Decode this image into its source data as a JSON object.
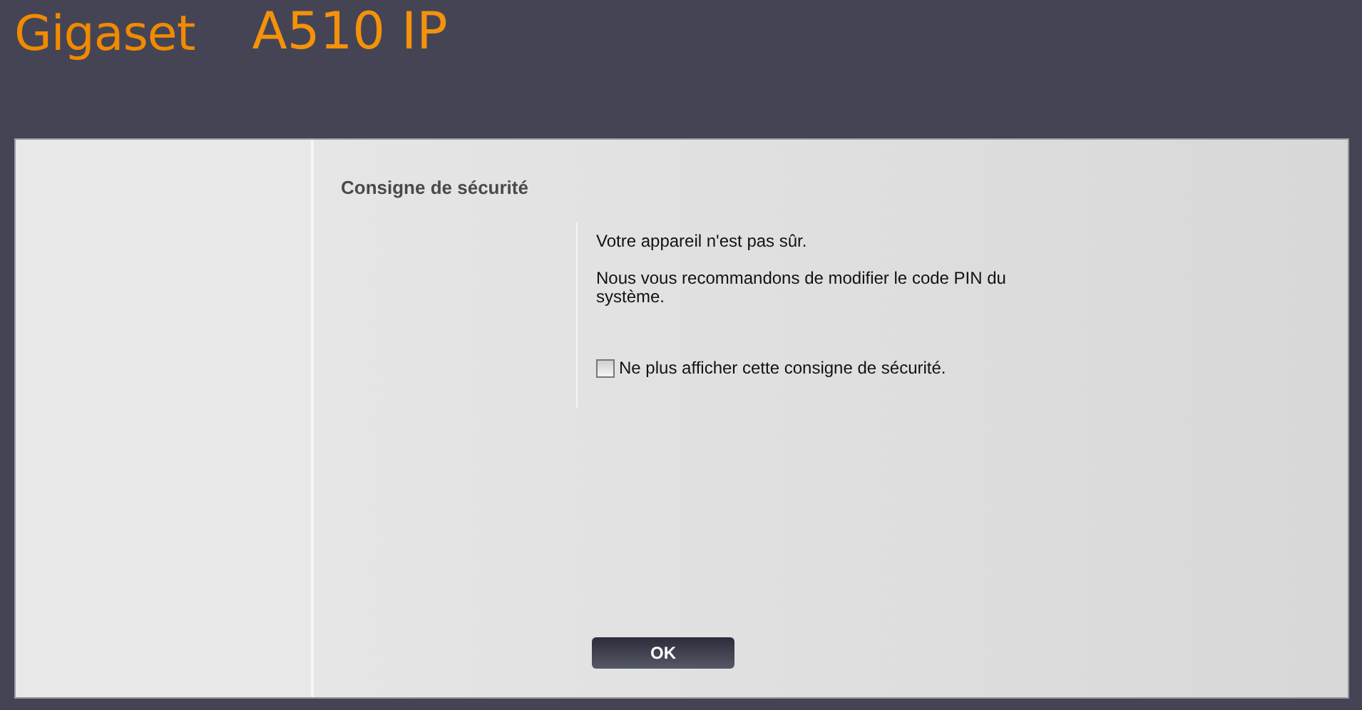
{
  "header": {
    "brand": "Gigaset",
    "model": "A510 IP"
  },
  "page": {
    "title": "Consigne de sécurité",
    "messages": [
      "Votre appareil n'est pas sûr.",
      "Nous vous recommandons de modifier le code PIN du système."
    ],
    "checkbox": {
      "label": "Ne plus afficher cette consigne de sécurité.",
      "checked": false
    },
    "buttons": [
      "OK"
    ]
  }
}
